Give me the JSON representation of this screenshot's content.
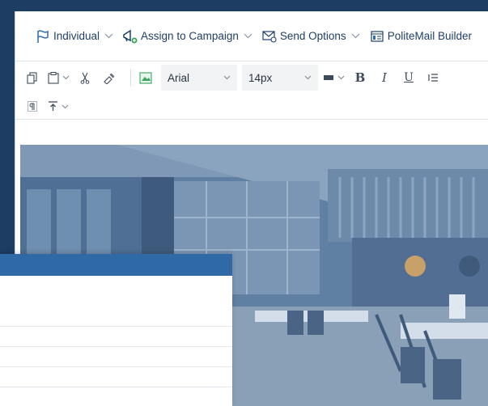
{
  "commandbar": {
    "items": [
      {
        "label": "Individual",
        "icon": "flag-icon",
        "has_dropdown": true
      },
      {
        "label": "Assign to Campaign",
        "icon": "megaphone-icon",
        "has_dropdown": true
      },
      {
        "label": "Send Options",
        "icon": "envelope-gear-icon",
        "has_dropdown": true
      },
      {
        "label": "PoliteMail Builder",
        "icon": "builder-icon",
        "has_dropdown": false
      }
    ]
  },
  "format": {
    "font_family": "Arial",
    "font_size": "14px",
    "bold": "B",
    "italic": "I",
    "underline": "U"
  },
  "colors": {
    "background": "#1d3d63",
    "brand": "#2f6aa6",
    "icon": "#1f3f66"
  }
}
